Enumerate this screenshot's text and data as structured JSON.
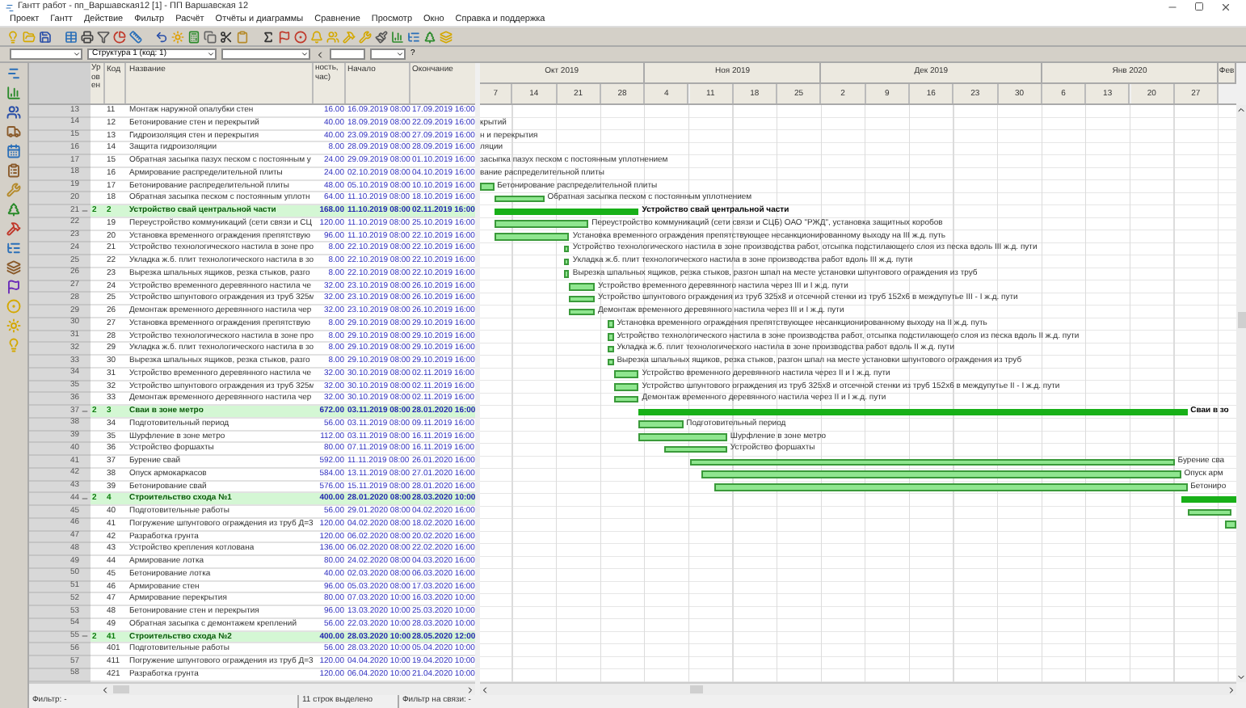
{
  "window": {
    "title": "Гантт работ - пп_Варшавская12 [1] - ПП Варшавская 12"
  },
  "menu": [
    "Проект",
    "Гантт",
    "Действие",
    "Фильтр",
    "Расчёт",
    "Отчёты и диаграммы",
    "Сравнение",
    "Просмотр",
    "Окно",
    "Справка и поддержка"
  ],
  "filter_bar": {
    "structure": "Структура 1 (код: 1)",
    "help": "?"
  },
  "columns": {
    "level": "Уровен",
    "code": "Код",
    "name": "Название",
    "hours": "ность, час)",
    "start": "Начало",
    "end": "Окончание"
  },
  "timeline": [
    {
      "month": "Окт 2019",
      "weeks": [
        "7",
        "14",
        "21",
        "28"
      ]
    },
    {
      "month": "Ноя 2019",
      "weeks": [
        "4",
        "11",
        "18",
        "25"
      ]
    },
    {
      "month": "Дек 2019",
      "weeks": [
        "2",
        "9",
        "16",
        "23",
        "30"
      ]
    },
    {
      "month": "Янв 2020",
      "weeks": [
        "6",
        "13",
        "20",
        "27"
      ]
    },
    {
      "month": "Фев"
    }
  ],
  "rows": [
    {
      "num": "13",
      "kind": "task",
      "code": "11",
      "name": "Монтаж наружной опалубки стен",
      "hours": "16.00",
      "start": "16.09.2019 08:00",
      "end": "17.09.2019 16:00"
    },
    {
      "num": "14",
      "kind": "task",
      "code": "12",
      "name": "Бетонирование стен и перекрытий",
      "hours": "40.00",
      "start": "18.09.2019 08:00",
      "end": "22.09.2019 16:00",
      "bar_label": "крытий"
    },
    {
      "num": "15",
      "kind": "task",
      "code": "13",
      "name": "Гидроизоляция стен и перекрытия",
      "hours": "40.00",
      "start": "23.09.2019 08:00",
      "end": "27.09.2019 16:00",
      "bar_label": "н и перекрытия"
    },
    {
      "num": "16",
      "kind": "task",
      "code": "14",
      "name": "Защита гидроизоляции",
      "hours": "8.00",
      "start": "28.09.2019 08:00",
      "end": "28.09.2019 16:00",
      "bar_label": "ляции"
    },
    {
      "num": "17",
      "kind": "task",
      "code": "15",
      "name": "Обратная засыпка пазух песком с постоянным у",
      "hours": "24.00",
      "start": "29.09.2019 08:00",
      "end": "01.10.2019 16:00",
      "bar_label": "засыпка пазух песком с постоянным уплотнением"
    },
    {
      "num": "18",
      "kind": "task",
      "code": "16",
      "name": "Армирование распределительной плиты",
      "hours": "24.00",
      "start": "02.10.2019 08:00",
      "end": "04.10.2019 16:00",
      "bar_label": "вание распределительной плиты"
    },
    {
      "num": "19",
      "kind": "task",
      "code": "17",
      "name": "Бетонирование распределительной плиты",
      "hours": "48.00",
      "start": "05.10.2019 08:00",
      "end": "10.10.2019 16:00",
      "bar_label": "Бетонирование распределительной плиты"
    },
    {
      "num": "20",
      "kind": "task",
      "code": "18",
      "name": "Обратная засыпка песком с постоянным уплотн",
      "hours": "64.00",
      "start": "11.10.2019 08:00",
      "end": "18.10.2019 16:00",
      "bar_label": "Обратная засыпка песком с постоянным уплотнением"
    },
    {
      "num": "21",
      "kind": "summary",
      "expanded": true,
      "level": "2",
      "code": "2",
      "name": "Устройство свай центральной части",
      "hours": "168.00",
      "start": "11.10.2019 08:00",
      "end": "02.11.2019 16:00",
      "bar_label": "Устройство свай центральной части"
    },
    {
      "num": "22",
      "kind": "task",
      "code": "19",
      "name": "Переустройство коммуникаций (сети связи и СЦ",
      "hours": "120.00",
      "start": "11.10.2019 08:00",
      "end": "25.10.2019 16:00",
      "bar_label": "Переустройство коммуникаций (сети связи и СЦБ) ОАО \"РЖД\", установка защитных коробов"
    },
    {
      "num": "23",
      "kind": "task",
      "code": "20",
      "name": "Установка временного ограждения препятствую",
      "hours": "96.00",
      "start": "11.10.2019 08:00",
      "end": "22.10.2019 16:00",
      "bar_label": "Установка временного ограждения препятствующее несанкционированному выходу на III ж.д. путь"
    },
    {
      "num": "24",
      "kind": "task",
      "code": "21",
      "name": "Устройство технологического настила в зоне про",
      "hours": "8.00",
      "start": "22.10.2019 08:00",
      "end": "22.10.2019 16:00",
      "bar_label": "Устройство технологического настила в зоне производства работ, отсыпка подстилающего слоя из песка вдоль III ж.д. пути"
    },
    {
      "num": "25",
      "kind": "task",
      "code": "22",
      "name": "Укладка ж.б. плит технологического настила в зо",
      "hours": "8.00",
      "start": "22.10.2019 08:00",
      "end": "22.10.2019 16:00",
      "bar_label": "Укладка ж.б. плит технологического настила в зоне производства работ вдоль III ж.д. пути"
    },
    {
      "num": "26",
      "kind": "task",
      "code": "23",
      "name": "Вырезка шпальных ящиков, резка стыков, разго",
      "hours": "8.00",
      "start": "22.10.2019 08:00",
      "end": "22.10.2019 16:00",
      "bar_label": "Вырезка шпальных ящиков, резка стыков, разгон шпал на месте установки шпунтового ограждения из труб"
    },
    {
      "num": "27",
      "kind": "task",
      "code": "24",
      "name": "Устройство временного деревянного настила че",
      "hours": "32.00",
      "start": "23.10.2019 08:00",
      "end": "26.10.2019 16:00",
      "bar_label": "Устройство временного деревянного настила через III и I ж.д. пути"
    },
    {
      "num": "28",
      "kind": "task",
      "code": "25",
      "name": "Устройство шпунтового ограждения из труб 325м",
      "hours": "32.00",
      "start": "23.10.2019 08:00",
      "end": "26.10.2019 16:00",
      "bar_label": "Устройство шпунтового ограждения из труб 325х8 и отсечной стенки из труб 152х6 в междупутье III - I ж.д. пути"
    },
    {
      "num": "29",
      "kind": "task",
      "code": "26",
      "name": "Демонтаж временного деревянного настила чер",
      "hours": "32.00",
      "start": "23.10.2019 08:00",
      "end": "26.10.2019 16:00",
      "bar_label": "Демонтаж временного деревянного настила через III и I ж.д. пути"
    },
    {
      "num": "30",
      "kind": "task",
      "code": "27",
      "name": "Установка временного ограждения препятствую",
      "hours": "8.00",
      "start": "29.10.2019 08:00",
      "end": "29.10.2019 16:00",
      "bar_label": "Установка временного ограждения препятствующее несанкционированному выходу на II ж.д. путь"
    },
    {
      "num": "31",
      "kind": "task",
      "code": "28",
      "name": "Устройство технологического настила в зоне про",
      "hours": "8.00",
      "start": "29.10.2019 08:00",
      "end": "29.10.2019 16:00",
      "bar_label": "Устройство технологического настила в зоне производства работ, отсыпка подстилающего слоя из песка вдоль II ж.д. пути"
    },
    {
      "num": "32",
      "kind": "task",
      "code": "29",
      "name": "Укладка ж.б. плит технологического настила в зо",
      "hours": "8.00",
      "start": "29.10.2019 08:00",
      "end": "29.10.2019 16:00",
      "bar_label": "Укладка ж.б. плит технологического настила в зоне производства работ вдоль II ж.д. пути"
    },
    {
      "num": "33",
      "kind": "task",
      "code": "30",
      "name": "Вырезка шпальных ящиков, резка стыков, разго",
      "hours": "8.00",
      "start": "29.10.2019 08:00",
      "end": "29.10.2019 16:00",
      "bar_label": "Вырезка шпальных ящиков, резка стыков, разгон шпал на месте установки шпунтового ограждения из труб"
    },
    {
      "num": "34",
      "kind": "task",
      "code": "31",
      "name": "Устройство временного деревянного настила че",
      "hours": "32.00",
      "start": "30.10.2019 08:00",
      "end": "02.11.2019 16:00",
      "bar_label": "Устройство временного деревянного настила через II и I ж.д. пути"
    },
    {
      "num": "35",
      "kind": "task",
      "code": "32",
      "name": "Устройство шпунтового ограждения из труб 325м",
      "hours": "32.00",
      "start": "30.10.2019 08:00",
      "end": "02.11.2019 16:00",
      "bar_label": "Устройство шпунтового ограждения из труб 325х8 и отсечной стенки из труб 152х6 в междупутье II - I ж.д. пути"
    },
    {
      "num": "36",
      "kind": "task",
      "code": "33",
      "name": "Демонтаж временного деревянного настила чер",
      "hours": "32.00",
      "start": "30.10.2019 08:00",
      "end": "02.11.2019 16:00",
      "bar_label": "Демонтаж временного деревянного настила через II и I ж.д. пути"
    },
    {
      "num": "37",
      "kind": "summary",
      "expanded": true,
      "level": "2",
      "code": "3",
      "name": "Сваи в зоне метро",
      "hours": "672.00",
      "start": "03.11.2019 08:00",
      "end": "28.01.2020 16:00",
      "bar_label": "Сваи в зо"
    },
    {
      "num": "38",
      "kind": "task",
      "code": "34",
      "name": "Подготовительный период",
      "hours": "56.00",
      "start": "03.11.2019 08:00",
      "end": "09.11.2019 16:00",
      "bar_label": "Подготовительный период"
    },
    {
      "num": "39",
      "kind": "task",
      "code": "35",
      "name": "Шурфление в зоне метро",
      "hours": "112.00",
      "start": "03.11.2019 08:00",
      "end": "16.11.2019 16:00",
      "bar_label": "Шурфление в зоне метро"
    },
    {
      "num": "40",
      "kind": "task",
      "code": "36",
      "name": "Устройство форшахты",
      "hours": "80.00",
      "start": "07.11.2019 08:00",
      "end": "16.11.2019 16:00",
      "bar_label": "Устройство форшахты"
    },
    {
      "num": "41",
      "kind": "task",
      "code": "37",
      "name": "Бурение свай",
      "hours": "592.00",
      "start": "11.11.2019 08:00",
      "end": "26.01.2020 16:00",
      "bar_label": "Бурение сва"
    },
    {
      "num": "42",
      "kind": "task",
      "code": "38",
      "name": "Опуск армокаркасов",
      "hours": "584.00",
      "start": "13.11.2019 08:00",
      "end": "27.01.2020 16:00",
      "bar_label": "Опуск арм"
    },
    {
      "num": "43",
      "kind": "task",
      "code": "39",
      "name": "Бетонирование свай",
      "hours": "576.00",
      "start": "15.11.2019 08:00",
      "end": "28.01.2020 16:00",
      "bar_label": "Бетониро"
    },
    {
      "num": "44",
      "kind": "summary",
      "expanded": true,
      "level": "2",
      "code": "4",
      "name": "Строительство схода №1",
      "hours": "400.00",
      "start": "28.01.2020 08:00",
      "end": "28.03.2020 10:00"
    },
    {
      "num": "45",
      "kind": "task",
      "code": "40",
      "name": "Подготовительные работы",
      "hours": "56.00",
      "start": "29.01.2020 08:00",
      "end": "04.02.2020 16:00"
    },
    {
      "num": "46",
      "kind": "task",
      "code": "41",
      "name": "Погружение шпунтового ограждения из труб Д=3",
      "hours": "120.00",
      "start": "04.02.2020 08:00",
      "end": "18.02.2020 16:00"
    },
    {
      "num": "47",
      "kind": "task",
      "code": "42",
      "name": "Разработка грунта",
      "hours": "120.00",
      "start": "06.02.2020 08:00",
      "end": "20.02.2020 16:00"
    },
    {
      "num": "48",
      "kind": "task",
      "code": "43",
      "name": "Устройство крепления котлована",
      "hours": "136.00",
      "start": "06.02.2020 08:00",
      "end": "22.02.2020 16:00"
    },
    {
      "num": "49",
      "kind": "task",
      "code": "44",
      "name": "Армирование лотка",
      "hours": "80.00",
      "start": "24.02.2020 08:00",
      "end": "04.03.2020 16:00"
    },
    {
      "num": "50",
      "kind": "task",
      "code": "45",
      "name": "Бетонирование лотка",
      "hours": "40.00",
      "start": "02.03.2020 08:00",
      "end": "06.03.2020 16:00"
    },
    {
      "num": "51",
      "kind": "task",
      "code": "46",
      "name": "Армирование стен",
      "hours": "96.00",
      "start": "05.03.2020 08:00",
      "end": "17.03.2020 16:00"
    },
    {
      "num": "52",
      "kind": "task",
      "code": "47",
      "name": "Армирование перекрытия",
      "hours": "80.00",
      "start": "07.03.2020 10:00",
      "end": "16.03.2020 10:00"
    },
    {
      "num": "53",
      "kind": "task",
      "code": "48",
      "name": "Бетонирование стен и перекрытия",
      "hours": "96.00",
      "start": "13.03.2020 10:00",
      "end": "25.03.2020 10:00"
    },
    {
      "num": "54",
      "kind": "task",
      "code": "49",
      "name": "Обратная засыпка с демонтажем креплений",
      "hours": "56.00",
      "start": "22.03.2020 10:00",
      "end": "28.03.2020 10:00"
    },
    {
      "num": "55",
      "kind": "summary",
      "expanded": true,
      "level": "2",
      "code": "41",
      "name": "Строительство схода №2",
      "hours": "400.00",
      "start": "28.03.2020 10:00",
      "end": "28.05.2020 12:00"
    },
    {
      "num": "56",
      "kind": "task",
      "code": "401",
      "name": "Подготовительные работы",
      "hours": "56.00",
      "start": "28.03.2020 10:00",
      "end": "05.04.2020 10:00"
    },
    {
      "num": "57",
      "kind": "task",
      "code": "411",
      "name": "Погружение шпунтового ограждения из труб Д=3",
      "hours": "120.00",
      "start": "04.04.2020 10:00",
      "end": "19.04.2020 10:00"
    },
    {
      "num": "58",
      "kind": "task",
      "code": "421",
      "name": "Разработка грунта",
      "hours": "120.00",
      "start": "06.04.2020 10:00",
      "end": "21.04.2020 10:00"
    }
  ],
  "status_bar": {
    "filter": "Фильтр: -",
    "selection": "11 строк выделено",
    "link_filter": "Фильтр на связи: -"
  }
}
